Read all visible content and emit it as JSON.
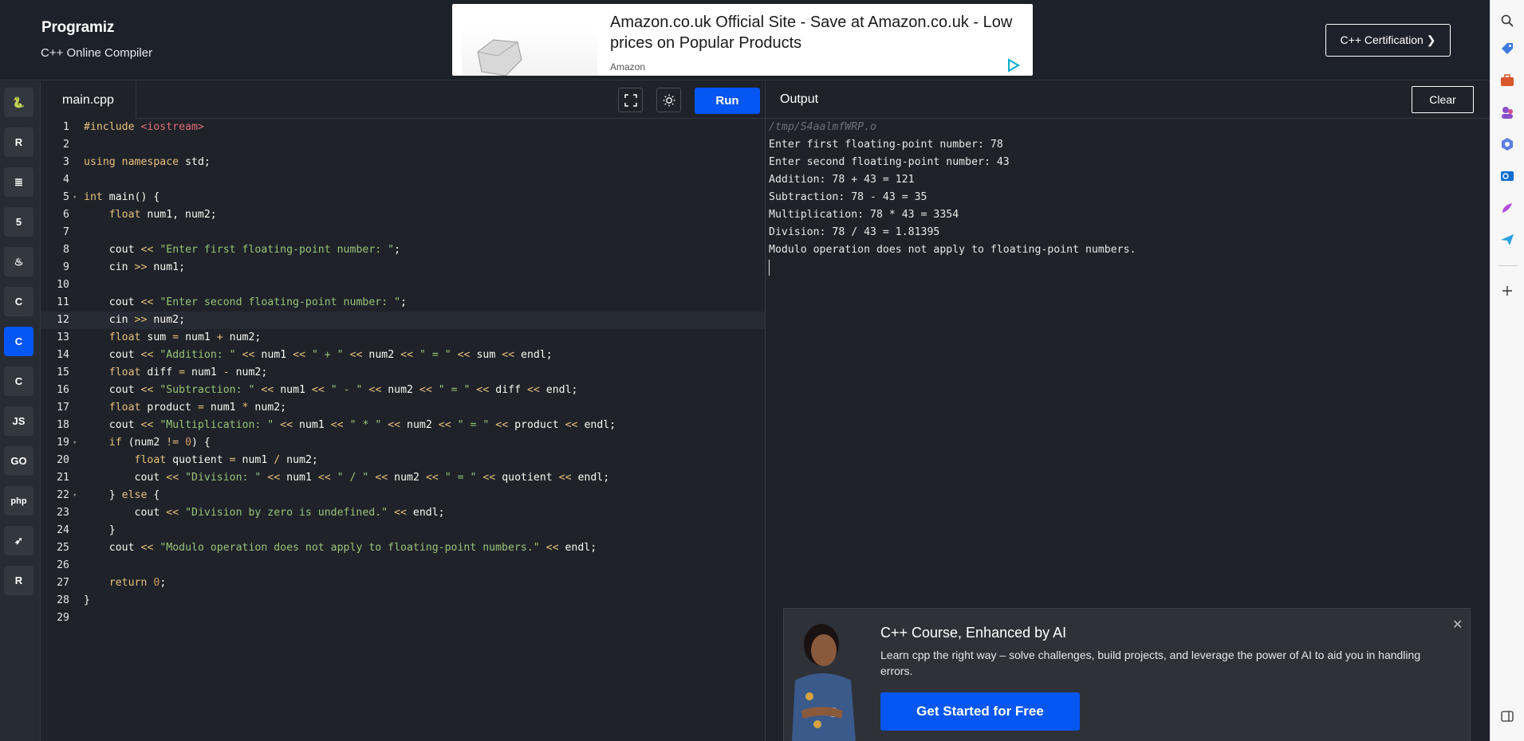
{
  "header": {
    "logo": "Programiz",
    "subtitle": "C++ Online Compiler",
    "certification_button": "C++ Certification ❯"
  },
  "ad": {
    "title": "Amazon.co.uk Official Site - Save at Amazon.co.uk - Low prices on Popular Products",
    "brand": "Amazon"
  },
  "sidebar": {
    "languages": [
      {
        "name": "python-icon",
        "glyph": "🐍"
      },
      {
        "name": "r-icon",
        "glyph": "R"
      },
      {
        "name": "sql-icon",
        "glyph": "≣"
      },
      {
        "name": "html-icon",
        "glyph": "5"
      },
      {
        "name": "java-icon",
        "glyph": "♨"
      },
      {
        "name": "c-icon",
        "glyph": "C"
      },
      {
        "name": "cpp-icon",
        "glyph": "C"
      },
      {
        "name": "csharp-icon",
        "glyph": "C"
      },
      {
        "name": "javascript-icon",
        "glyph": "JS"
      },
      {
        "name": "go-icon",
        "glyph": "GO"
      },
      {
        "name": "php-icon",
        "glyph": "php"
      },
      {
        "name": "swift-icon",
        "glyph": "➶"
      },
      {
        "name": "rust-icon",
        "glyph": "R"
      }
    ]
  },
  "editor": {
    "tab": "main.cpp",
    "run_label": "Run",
    "lines": [
      "#include <iostream>",
      "",
      "using namespace std;",
      "",
      "int main() {",
      "    float num1, num2;",
      "",
      "    cout << \"Enter first floating-point number: \";",
      "    cin >> num1;",
      "",
      "    cout << \"Enter second floating-point number: \";",
      "    cin >> num2;",
      "    float sum = num1 + num2;",
      "    cout << \"Addition: \" << num1 << \" + \" << num2 << \" = \" << sum << endl;",
      "    float diff = num1 - num2;",
      "    cout << \"Subtraction: \" << num1 << \" - \" << num2 << \" = \" << diff << endl;",
      "    float product = num1 * num2;",
      "    cout << \"Multiplication: \" << num1 << \" * \" << num2 << \" = \" << product << endl;",
      "    if (num2 != 0) {",
      "        float quotient = num1 / num2;",
      "        cout << \"Division: \" << num1 << \" / \" << num2 << \" = \" << quotient << endl;",
      "    } else {",
      "        cout << \"Division by zero is undefined.\" << endl;",
      "    }",
      "    cout << \"Modulo operation does not apply to floating-point numbers.\" << endl;",
      "",
      "    return 0;",
      "}",
      ""
    ]
  },
  "output": {
    "title": "Output",
    "clear_label": "Clear",
    "lines": [
      "/tmp/S4aalmfWRP.o",
      "Enter first floating-point number: 78",
      "Enter second floating-point number: 43",
      "Addition: 78 + 43 = 121",
      "Subtraction: 78 - 43 = 35",
      "Multiplication: 78 * 43 = 3354",
      "Division: 78 / 43 = 1.81395",
      "Modulo operation does not apply to floating-point numbers."
    ]
  },
  "promo": {
    "title": "C++ Course, Enhanced by AI",
    "description": "Learn cpp the right way – solve challenges, build projects, and leverage the power of AI to aid you in handling errors.",
    "cta": "Get Started for Free",
    "close": "✕"
  },
  "colors": {
    "accent": "#0556f3",
    "background": "#1f2229"
  }
}
